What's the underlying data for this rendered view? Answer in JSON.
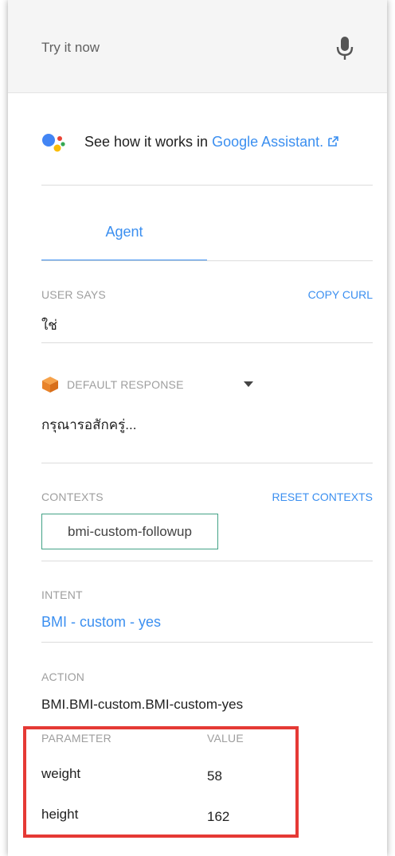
{
  "header": {
    "try_label": "Try it now"
  },
  "assistant": {
    "prefix": "See how it works in ",
    "link": "Google Assistant."
  },
  "tabs": [
    {
      "label": "Agent"
    }
  ],
  "user_says": {
    "caption": "USER SAYS",
    "copy_curl": "COPY CURL",
    "value": "ใช่"
  },
  "response": {
    "caption": "DEFAULT RESPONSE",
    "value": "กรุณารอสักครู่..."
  },
  "contexts": {
    "caption": "CONTEXTS",
    "reset": "RESET CONTEXTS",
    "items": [
      "bmi-custom-followup"
    ]
  },
  "intent": {
    "caption": "INTENT",
    "value": "BMI - custom - yes"
  },
  "action": {
    "caption": "ACTION",
    "value": "BMI.BMI-custom.BMI-custom-yes"
  },
  "parameters": {
    "header_param": "PARAMETER",
    "header_value": "VALUE",
    "rows": [
      {
        "name": "weight",
        "value": "58"
      },
      {
        "name": "height",
        "value": "162"
      }
    ]
  },
  "colors": {
    "accent": "#3b8ff0",
    "context_border": "#43a286",
    "highlight": "#e53935",
    "ga_blue": "#4285f4",
    "ga_red": "#ea4335",
    "ga_yellow": "#fbbc04",
    "ga_green": "#34a853"
  },
  "icons": [
    "microphone-icon",
    "google-assistant-icon",
    "external-link-icon",
    "response-cube-icon",
    "dropdown-caret-icon"
  ]
}
